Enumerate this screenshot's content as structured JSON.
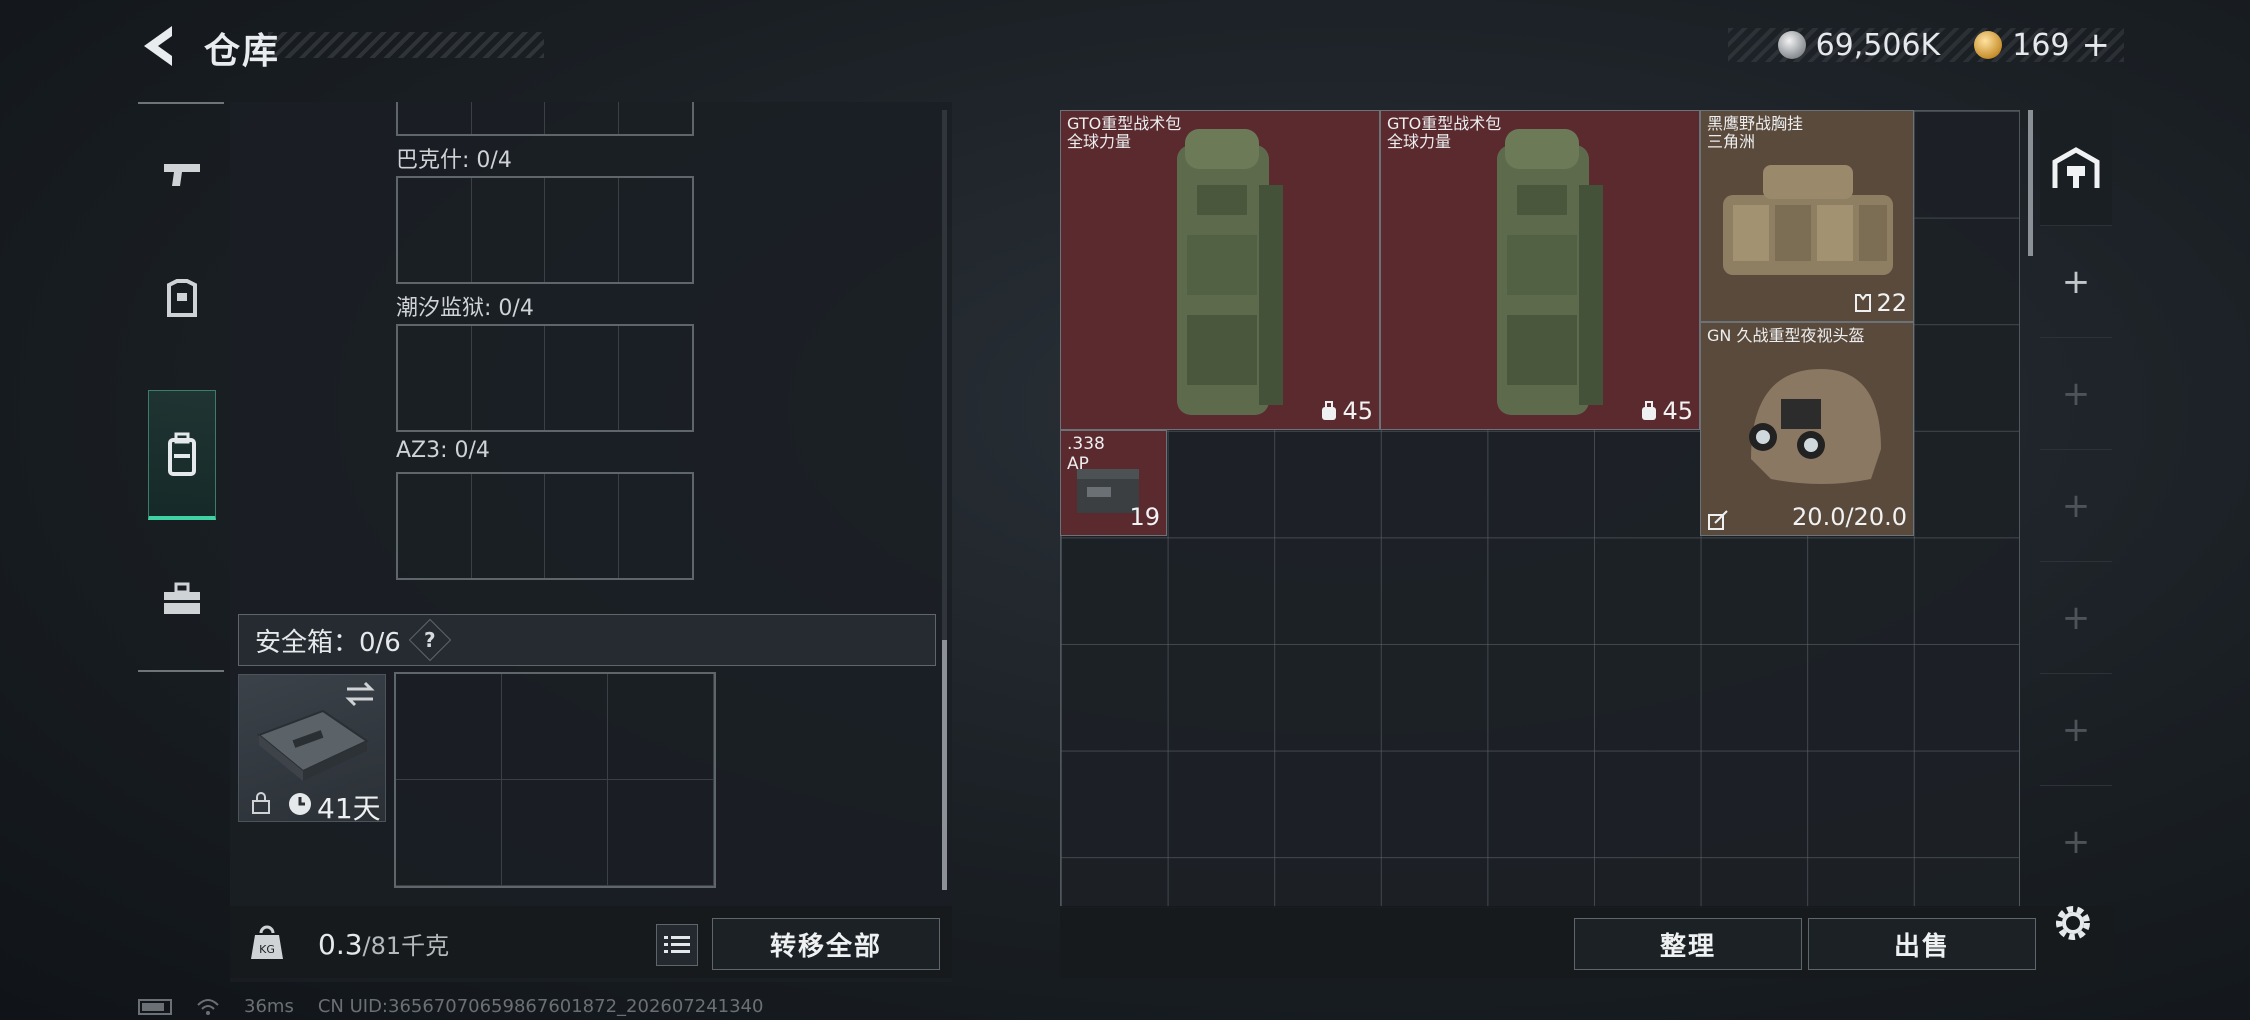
{
  "header": {
    "title": "仓库"
  },
  "currency": [
    {
      "icon": "silver-coin-icon",
      "value": "69,506K"
    },
    {
      "icon": "gold-coin-icon",
      "value": "169"
    }
  ],
  "currency_plus": "+",
  "left_rail": {
    "items": [
      {
        "icon": "pistol-icon"
      },
      {
        "icon": "armor-icon"
      },
      {
        "icon": "backpack-icon",
        "active": true
      },
      {
        "icon": "toolbox-icon"
      }
    ]
  },
  "left_panel": {
    "slots": [
      {
        "label": "巴克什: 0/4"
      },
      {
        "label": "潮汐监狱: 0/4"
      },
      {
        "label": "AZ3: 0/4"
      }
    ],
    "safe_box": {
      "label": "安全箱：0/6",
      "help": "?",
      "item_timer": "41天"
    },
    "weight": {
      "value": "0.3",
      "max": "/81",
      "unit": "千克"
    },
    "transfer_all": "转移全部"
  },
  "stash": {
    "items": [
      {
        "name": "GTO重型战术包",
        "sub": "全球力量",
        "count": "45"
      },
      {
        "name": "GTO重型战术包",
        "sub": "全球力量",
        "count": "45"
      },
      {
        "name": "黑鹰野战胸挂",
        "sub": "三角洲",
        "count": "22"
      },
      {
        "name": "GN 久战重型夜视头盔",
        "sub": "",
        "count": "20.0/20.0"
      },
      {
        "name": ".338",
        "sub": "AP",
        "count": "19"
      }
    ],
    "add_slots": [
      "+",
      "+",
      "+",
      "+",
      "+",
      "+"
    ],
    "buttons": {
      "sort": "整理",
      "sell": "出售"
    }
  },
  "status_bar": {
    "ping": "36ms",
    "uid": "CN UID:3656707065986760187​2_202607241340"
  },
  "colors": {
    "accent": "#3fd3a3",
    "item_red": "#5a2a2f",
    "item_brown": "#5a4a3c"
  }
}
